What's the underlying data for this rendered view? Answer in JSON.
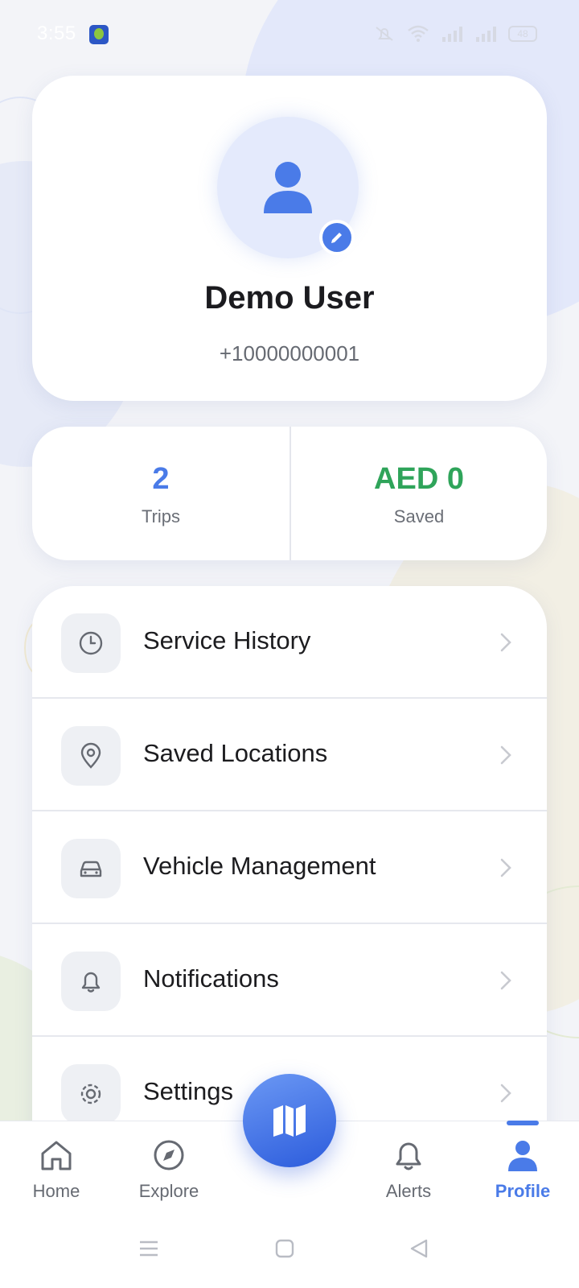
{
  "status_bar": {
    "time": "3:55",
    "battery": "48"
  },
  "profile": {
    "name": "Demo User",
    "phone": "+10000000001"
  },
  "stats": [
    {
      "value": "2",
      "label": "Trips",
      "color": "#4a7be8"
    },
    {
      "value": "AED 0",
      "label": "Saved",
      "color": "#2fa45a"
    }
  ],
  "menu": {
    "items": [
      {
        "label": "Service History",
        "icon": "clock-icon"
      },
      {
        "label": "Saved Locations",
        "icon": "map-pin-icon"
      },
      {
        "label": "Vehicle Management",
        "icon": "car-icon"
      },
      {
        "label": "Notifications",
        "icon": "bell-icon"
      },
      {
        "label": "Settings",
        "icon": "gear-icon"
      }
    ]
  },
  "bottom_nav": {
    "items": [
      {
        "label": "Home",
        "icon": "home-icon"
      },
      {
        "label": "Explore",
        "icon": "compass-icon"
      },
      {
        "label": "Alerts",
        "icon": "bell-icon"
      },
      {
        "label": "Profile",
        "icon": "user-icon",
        "active": true
      }
    ],
    "center_action_icon": "map-icon"
  },
  "colors": {
    "accent": "#4a7be8",
    "success": "#2fa45a",
    "background": "#f3f4f8"
  }
}
